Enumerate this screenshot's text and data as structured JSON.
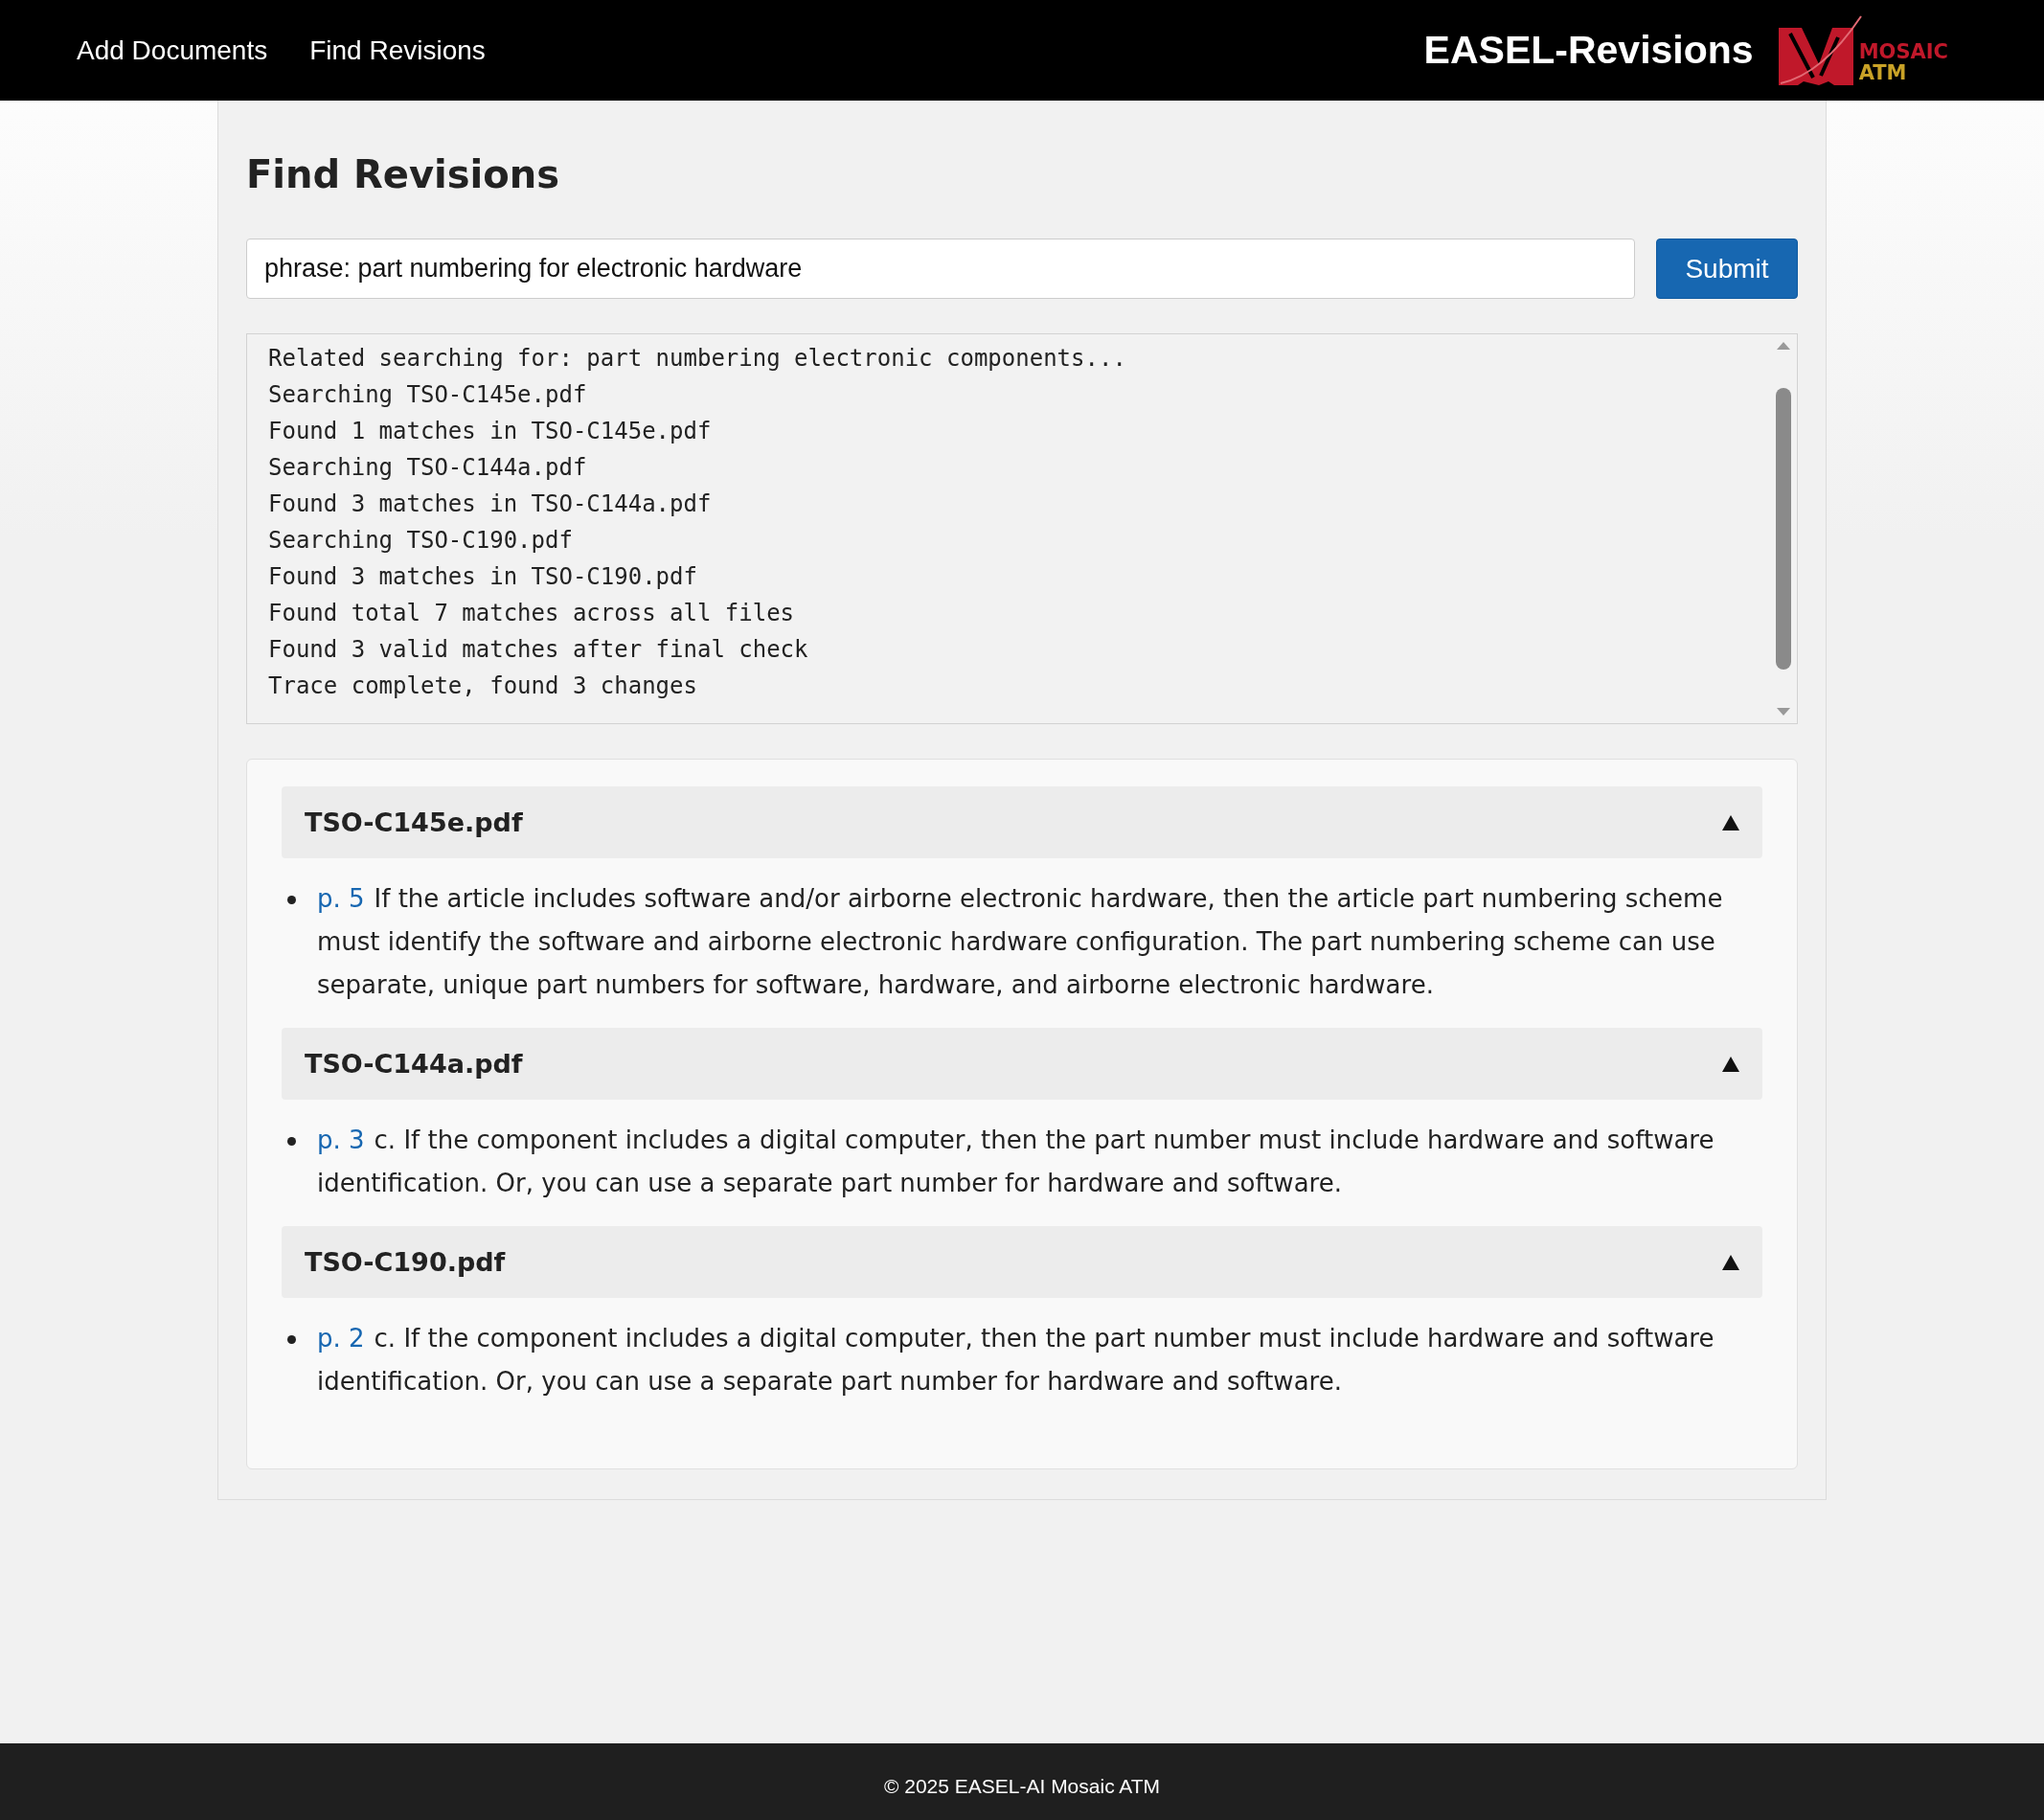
{
  "nav": {
    "links": [
      {
        "label": "Add Documents",
        "selected": false
      },
      {
        "label": "Find Revisions",
        "selected": false
      }
    ],
    "app_title": "EASEL-Revisions",
    "logo": {
      "line_1": "MOSAIC",
      "line_2": "ATM"
    }
  },
  "page": {
    "title": "Find Revisions",
    "search": {
      "value": "phrase: part numbering for electronic hardware"
    },
    "submit": "Submit",
    "log": [
      "Related searching for: part numbering electronic components...",
      "Searching TSO-C145e.pdf",
      "Found 1 matches in TSO-C145e.pdf",
      "Searching TSO-C144a.pdf",
      "Found 3 matches in TSO-C144a.pdf",
      "Searching TSO-C190.pdf",
      "Found 3 matches in TSO-C190.pdf",
      "Found total 7 matches across all files",
      "Found 3 valid matches after final check",
      "Trace complete, found 3 changes"
    ],
    "results": [
      {
        "file": "TSO-C145e.pdf",
        "expanded": true,
        "matches": [
          {
            "page": "p. 5",
            "text": "If the article includes software and/or airborne electronic hardware, then the article part numbering scheme must identify the software and airborne electronic hardware configuration. The part numbering scheme can use separate, unique part numbers for software, hardware, and airborne electronic hardware."
          }
        ]
      },
      {
        "file": "TSO-C144a.pdf",
        "expanded": true,
        "matches": [
          {
            "page": "p. 3",
            "text": "c. If the component includes a digital computer, then the part number must include hardware and software identification. Or, you can use a separate part number for hardware and software."
          }
        ]
      },
      {
        "file": "TSO-C190.pdf",
        "expanded": true,
        "matches": [
          {
            "page": "p. 2",
            "text": "c. If the component includes a digital computer, then the part number must include hardware and software identification. Or, you can use a separate part number for hardware and software."
          }
        ]
      }
    ]
  },
  "footer": "© 2025 EASEL-AI Mosaic ATM"
}
